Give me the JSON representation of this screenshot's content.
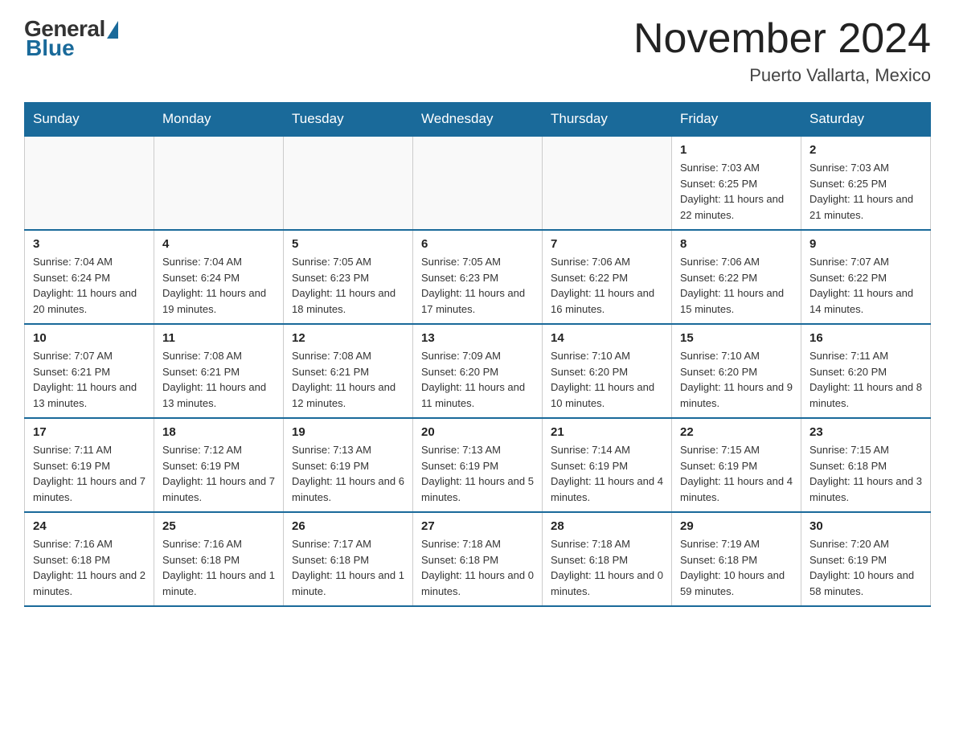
{
  "header": {
    "logo": {
      "general": "General",
      "blue": "Blue"
    },
    "title": "November 2024",
    "location": "Puerto Vallarta, Mexico"
  },
  "calendar": {
    "days_of_week": [
      "Sunday",
      "Monday",
      "Tuesday",
      "Wednesday",
      "Thursday",
      "Friday",
      "Saturday"
    ],
    "weeks": [
      [
        {
          "day": "",
          "info": ""
        },
        {
          "day": "",
          "info": ""
        },
        {
          "day": "",
          "info": ""
        },
        {
          "day": "",
          "info": ""
        },
        {
          "day": "",
          "info": ""
        },
        {
          "day": "1",
          "info": "Sunrise: 7:03 AM\nSunset: 6:25 PM\nDaylight: 11 hours and 22 minutes."
        },
        {
          "day": "2",
          "info": "Sunrise: 7:03 AM\nSunset: 6:25 PM\nDaylight: 11 hours and 21 minutes."
        }
      ],
      [
        {
          "day": "3",
          "info": "Sunrise: 7:04 AM\nSunset: 6:24 PM\nDaylight: 11 hours and 20 minutes."
        },
        {
          "day": "4",
          "info": "Sunrise: 7:04 AM\nSunset: 6:24 PM\nDaylight: 11 hours and 19 minutes."
        },
        {
          "day": "5",
          "info": "Sunrise: 7:05 AM\nSunset: 6:23 PM\nDaylight: 11 hours and 18 minutes."
        },
        {
          "day": "6",
          "info": "Sunrise: 7:05 AM\nSunset: 6:23 PM\nDaylight: 11 hours and 17 minutes."
        },
        {
          "day": "7",
          "info": "Sunrise: 7:06 AM\nSunset: 6:22 PM\nDaylight: 11 hours and 16 minutes."
        },
        {
          "day": "8",
          "info": "Sunrise: 7:06 AM\nSunset: 6:22 PM\nDaylight: 11 hours and 15 minutes."
        },
        {
          "day": "9",
          "info": "Sunrise: 7:07 AM\nSunset: 6:22 PM\nDaylight: 11 hours and 14 minutes."
        }
      ],
      [
        {
          "day": "10",
          "info": "Sunrise: 7:07 AM\nSunset: 6:21 PM\nDaylight: 11 hours and 13 minutes."
        },
        {
          "day": "11",
          "info": "Sunrise: 7:08 AM\nSunset: 6:21 PM\nDaylight: 11 hours and 13 minutes."
        },
        {
          "day": "12",
          "info": "Sunrise: 7:08 AM\nSunset: 6:21 PM\nDaylight: 11 hours and 12 minutes."
        },
        {
          "day": "13",
          "info": "Sunrise: 7:09 AM\nSunset: 6:20 PM\nDaylight: 11 hours and 11 minutes."
        },
        {
          "day": "14",
          "info": "Sunrise: 7:10 AM\nSunset: 6:20 PM\nDaylight: 11 hours and 10 minutes."
        },
        {
          "day": "15",
          "info": "Sunrise: 7:10 AM\nSunset: 6:20 PM\nDaylight: 11 hours and 9 minutes."
        },
        {
          "day": "16",
          "info": "Sunrise: 7:11 AM\nSunset: 6:20 PM\nDaylight: 11 hours and 8 minutes."
        }
      ],
      [
        {
          "day": "17",
          "info": "Sunrise: 7:11 AM\nSunset: 6:19 PM\nDaylight: 11 hours and 7 minutes."
        },
        {
          "day": "18",
          "info": "Sunrise: 7:12 AM\nSunset: 6:19 PM\nDaylight: 11 hours and 7 minutes."
        },
        {
          "day": "19",
          "info": "Sunrise: 7:13 AM\nSunset: 6:19 PM\nDaylight: 11 hours and 6 minutes."
        },
        {
          "day": "20",
          "info": "Sunrise: 7:13 AM\nSunset: 6:19 PM\nDaylight: 11 hours and 5 minutes."
        },
        {
          "day": "21",
          "info": "Sunrise: 7:14 AM\nSunset: 6:19 PM\nDaylight: 11 hours and 4 minutes."
        },
        {
          "day": "22",
          "info": "Sunrise: 7:15 AM\nSunset: 6:19 PM\nDaylight: 11 hours and 4 minutes."
        },
        {
          "day": "23",
          "info": "Sunrise: 7:15 AM\nSunset: 6:18 PM\nDaylight: 11 hours and 3 minutes."
        }
      ],
      [
        {
          "day": "24",
          "info": "Sunrise: 7:16 AM\nSunset: 6:18 PM\nDaylight: 11 hours and 2 minutes."
        },
        {
          "day": "25",
          "info": "Sunrise: 7:16 AM\nSunset: 6:18 PM\nDaylight: 11 hours and 1 minute."
        },
        {
          "day": "26",
          "info": "Sunrise: 7:17 AM\nSunset: 6:18 PM\nDaylight: 11 hours and 1 minute."
        },
        {
          "day": "27",
          "info": "Sunrise: 7:18 AM\nSunset: 6:18 PM\nDaylight: 11 hours and 0 minutes."
        },
        {
          "day": "28",
          "info": "Sunrise: 7:18 AM\nSunset: 6:18 PM\nDaylight: 11 hours and 0 minutes."
        },
        {
          "day": "29",
          "info": "Sunrise: 7:19 AM\nSunset: 6:18 PM\nDaylight: 10 hours and 59 minutes."
        },
        {
          "day": "30",
          "info": "Sunrise: 7:20 AM\nSunset: 6:19 PM\nDaylight: 10 hours and 58 minutes."
        }
      ]
    ]
  }
}
